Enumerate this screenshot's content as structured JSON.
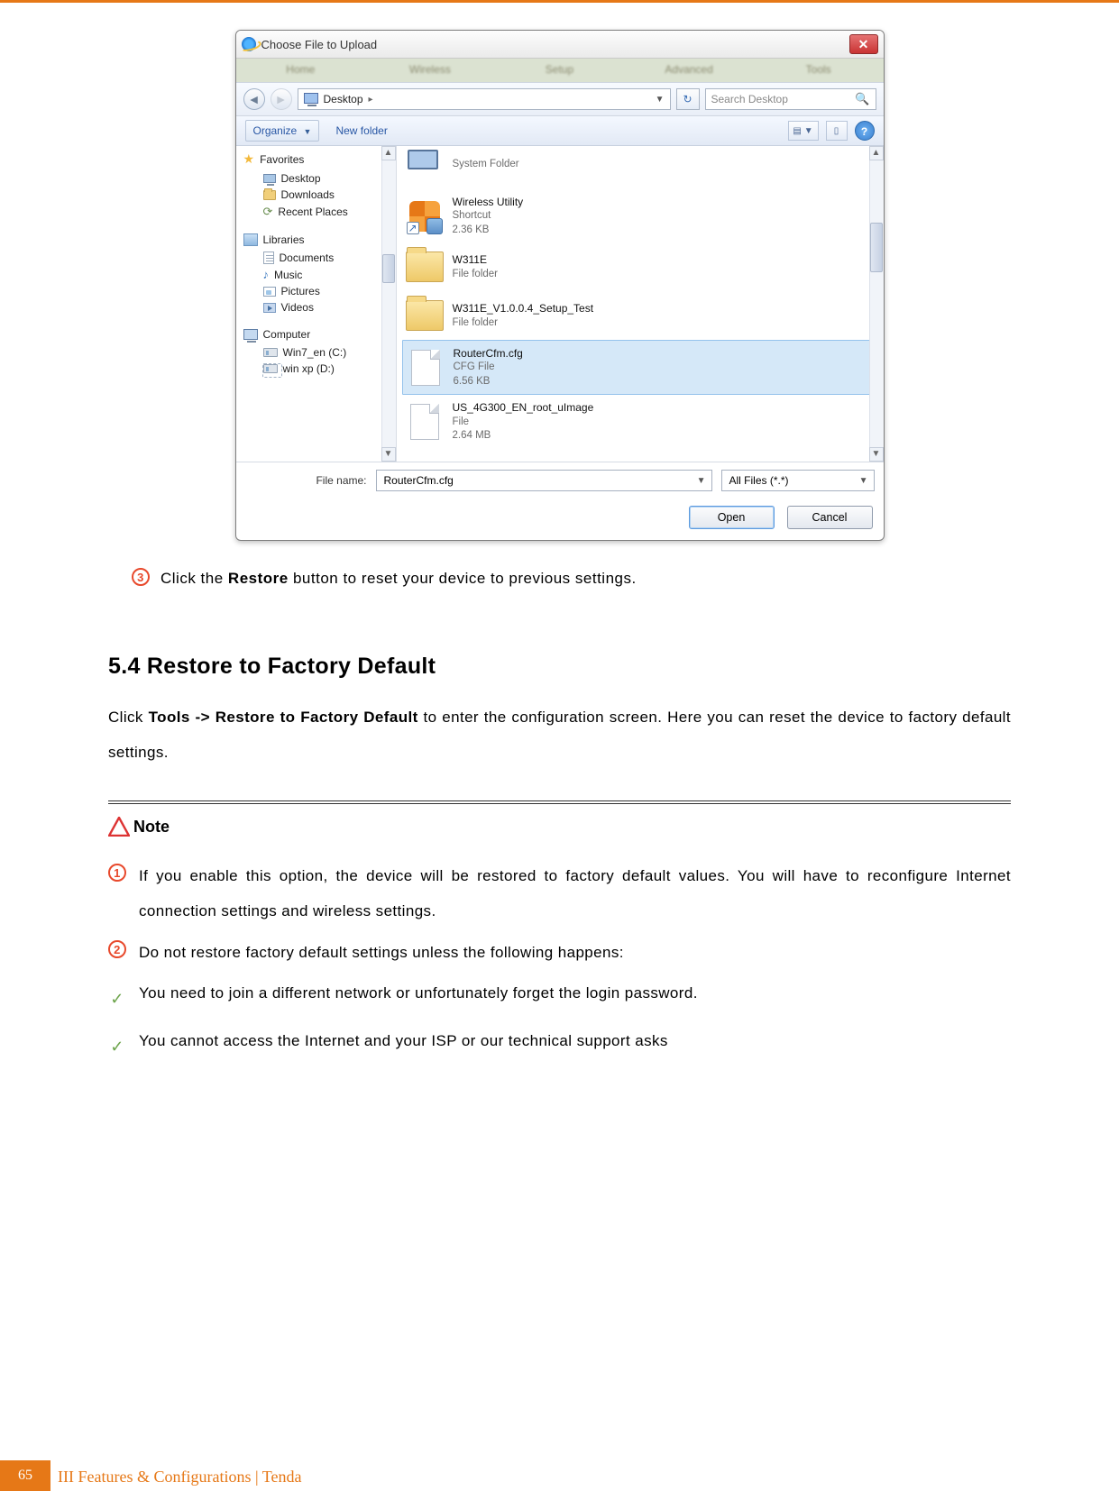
{
  "dialog": {
    "title": "Choose File to Upload",
    "blur_tabs": [
      "Home",
      "Wireless",
      "Setup",
      "Advanced",
      "Tools"
    ],
    "location_crumb": "Desktop",
    "location_arrow": "▸",
    "refresh_glyph": "↻",
    "search_placeholder": "Search Desktop",
    "close_glyph": "✕",
    "back_glyph": "◄",
    "fwd_glyph": "►",
    "organize_label": "Organize",
    "organize_tri": "▼",
    "newfolder_label": "New folder",
    "view_glyph": "▤",
    "view_tri": "▼",
    "pane_glyph": "▯",
    "help_glyph": "?",
    "tree_up_glyph": "▲",
    "tree_down_glyph": "▼",
    "tree": {
      "favorites": {
        "header": "Favorites",
        "items": [
          "Desktop",
          "Downloads",
          "Recent Places"
        ]
      },
      "libraries": {
        "header": "Libraries",
        "items": [
          "Documents",
          "Music",
          "Pictures",
          "Videos"
        ]
      },
      "computer": {
        "header": "Computer",
        "items": [
          "Win7_en (C:)",
          "win xp (D:)"
        ]
      }
    },
    "files": [
      {
        "name": "",
        "sub1": "System Folder",
        "sub2": "",
        "icon": "sysfolder",
        "selected": false
      },
      {
        "name": "Wireless Utility",
        "sub1": "Shortcut",
        "sub2": "2.36 KB",
        "icon": "wireless",
        "selected": false
      },
      {
        "name": "W311E",
        "sub1": "File folder",
        "sub2": "",
        "icon": "folder",
        "selected": false
      },
      {
        "name": "W311E_V1.0.0.4_Setup_Test",
        "sub1": "File folder",
        "sub2": "",
        "icon": "folder",
        "selected": false
      },
      {
        "name": "RouterCfm.cfg",
        "sub1": "CFG File",
        "sub2": "6.56 KB",
        "icon": "file",
        "selected": true
      },
      {
        "name": "US_4G300_EN_root_uImage",
        "sub1": "File",
        "sub2": "2.64 MB",
        "icon": "file",
        "selected": false
      }
    ],
    "filename_label": "File name:",
    "filename_value": "RouterCfm.cfg",
    "combo_tri": "▼",
    "filter_value": "All Files (*.*)",
    "open_label": "Open",
    "cancel_label": "Cancel"
  },
  "body": {
    "step3_marker": "3",
    "step3_pre": "Click the ",
    "step3_bold": "Restore",
    "step3_post": " button to reset your device to previous settings.",
    "heading": "5.4 Restore to Factory Default",
    "para_pre": "Click ",
    "para_bold": "Tools -> Restore to Factory Default",
    "para_post": " to enter the configuration screen. Here you can reset the device to factory default settings.",
    "note_label": "Note",
    "note1_marker": "1",
    "note1": "If you enable this option, the device will be restored to factory default values. You will have to reconfigure Internet connection settings and wireless settings.",
    "note2_marker": "2",
    "note2": "Do not restore factory default settings unless the following happens:",
    "tick_glyph": "✓",
    "tick1": "You need to join a different network or unfortunately forget the login password.",
    "tick2": "You cannot access the Internet and your ISP or our technical support asks"
  },
  "footer": {
    "page_number": "65",
    "text": "III Features & Configurations | Tenda"
  }
}
